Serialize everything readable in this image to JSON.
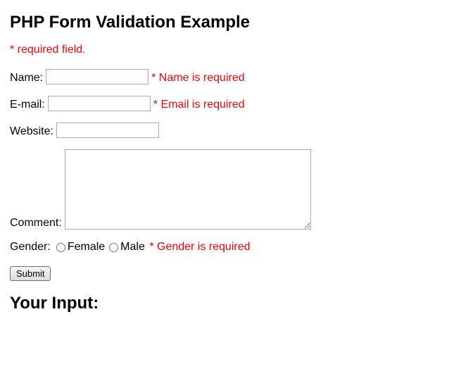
{
  "heading": "PHP Form Validation Example",
  "required_note": "* required field.",
  "form": {
    "name": {
      "label": "Name:",
      "value": "",
      "error": "* Name is required"
    },
    "email": {
      "label": "E-mail:",
      "value": "",
      "error": "* Email is required"
    },
    "website": {
      "label": "Website:",
      "value": "",
      "error": ""
    },
    "comment": {
      "label": "Comment:",
      "value": ""
    },
    "gender": {
      "label": "Gender:",
      "options": {
        "female": "Female",
        "male": "Male"
      },
      "error": "* Gender is required"
    },
    "submit": "Submit"
  },
  "output_heading": "Your Input:"
}
